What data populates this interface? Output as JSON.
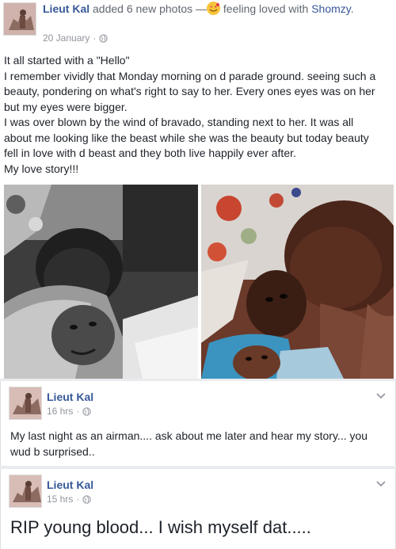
{
  "post1": {
    "author": "Lieut Kal",
    "action": "added 6 new photos",
    "separator": "—",
    "feeling": "feeling loved with",
    "tagged": "Shomzy",
    "tagged_after": ".",
    "date": "20 January",
    "date_dot": "·",
    "lines": [
      "It all started with a \"Hello\"",
      "I remember vividly that Monday morning on d parade ground. seeing such a",
      "beauty, pondering on what's right to say to her. Every ones eyes was on her",
      "but my eyes were bigger.",
      "I was over blown by the wind of bravado, standing next to her. It was all",
      "about me looking like the beast while she was the beauty but today beauty",
      "fell in love with d beast and they both live happily ever after.",
      "My love story!!!"
    ]
  },
  "post2": {
    "author": "Lieut Kal",
    "time": "16 hrs",
    "dot": "·",
    "lines": [
      "My last night as an airman.... ask about me later and hear my story... you",
      "wud b surprised.."
    ]
  },
  "post3": {
    "author": "Lieut Kal",
    "time": "15 hrs",
    "dot": "·",
    "text": "RIP young blood... I wish myself dat....."
  },
  "icons": {
    "privacy": "globe-icon",
    "menu": "chevron-down-icon",
    "feeling": "smiling-face-with-hearts-emoji"
  },
  "colors": {
    "link": "#365899",
    "meta": "#90949c",
    "text": "#1d2129"
  }
}
